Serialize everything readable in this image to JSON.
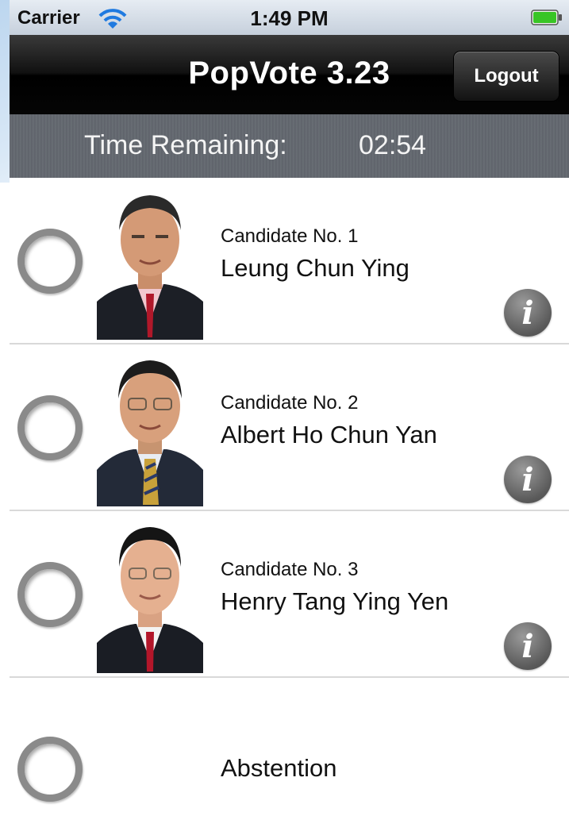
{
  "status_bar": {
    "carrier": "Carrier",
    "time": "1:49 PM",
    "wifi_icon": "wifi-icon",
    "battery_icon": "battery-icon",
    "battery_color": "#38c526"
  },
  "nav": {
    "title": "PopVote 3.23",
    "logout_label": "Logout"
  },
  "timer": {
    "label": "Time Remaining:",
    "value": "02:54"
  },
  "candidates": [
    {
      "number_label": "Candidate No.  1",
      "name": "Leung Chun Ying",
      "info_icon": "info-icon"
    },
    {
      "number_label": "Candidate No.  2",
      "name": "Albert Ho Chun Yan",
      "info_icon": "info-icon"
    },
    {
      "number_label": "Candidate No.  3",
      "name": "Henry Tang Ying Yen",
      "info_icon": "info-icon"
    }
  ],
  "abstention": {
    "label": "Abstention"
  },
  "colors": {
    "nav_background": "#0a0a0a",
    "timer_background": "#62676e",
    "radio_ring": "#8a8a8a",
    "info_button": "#6b6b6b"
  }
}
